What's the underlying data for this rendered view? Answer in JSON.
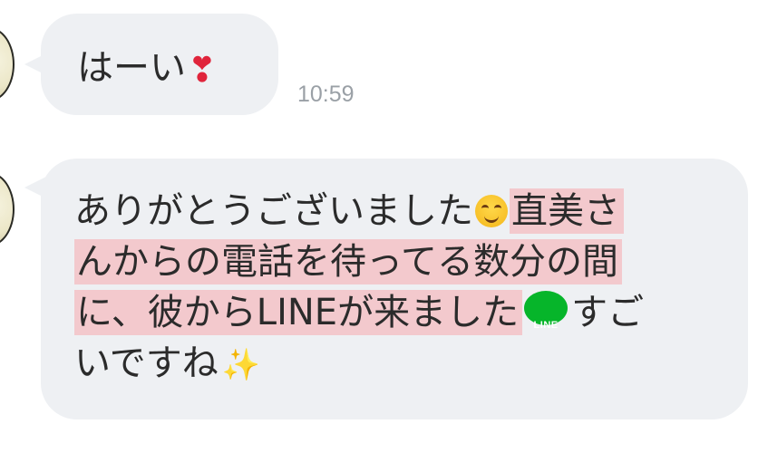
{
  "messages": [
    {
      "text": "はーい",
      "emoji_icon": "heart-exclamation-icon",
      "time": "10:59"
    },
    {
      "line1_plain": "ありがとうございました",
      "line1_emoji_icon": "smiling-face-icon",
      "line1_highlight": "直美さ",
      "line2_highlight": "んからの電話を待ってる数分の間",
      "line3_highlight": "に、彼からLINEが来ました",
      "line3_logo_text": "LINE",
      "line3_plain": "すご",
      "line4_plain": "いですね",
      "line4_emoji_icon": "sparkles-icon"
    }
  ],
  "colors": {
    "bubble_bg": "#eef0f3",
    "highlight": "#f3c9cd",
    "timestamp": "#9aa0a6",
    "line_brand": "#06b52a"
  }
}
